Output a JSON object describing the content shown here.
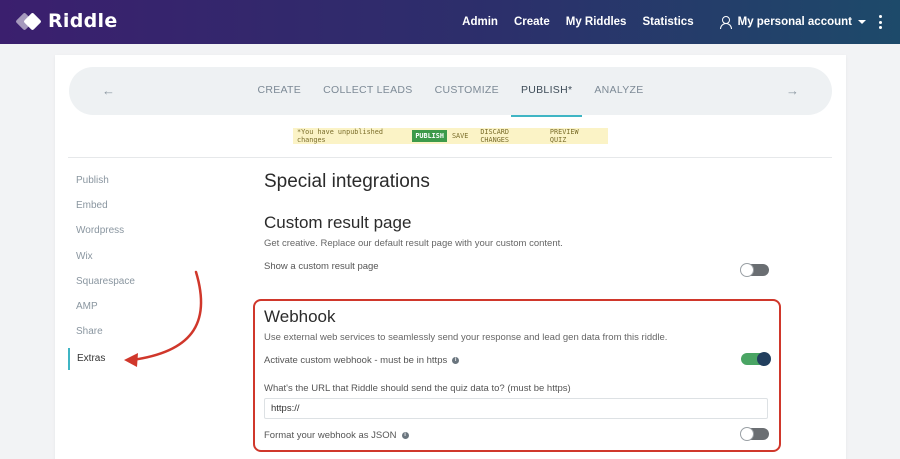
{
  "app": {
    "name": "Riddle"
  },
  "topnav": {
    "links": [
      "Admin",
      "Create",
      "My Riddles",
      "Statistics"
    ],
    "account_label": "My personal account"
  },
  "stepper": {
    "steps": [
      {
        "label": "CREATE",
        "active": false
      },
      {
        "label": "COLLECT LEADS",
        "active": false
      },
      {
        "label": "CUSTOMIZE",
        "active": false
      },
      {
        "label": "PUBLISH*",
        "active": true
      },
      {
        "label": "ANALYZE",
        "active": false
      }
    ],
    "prev_arrow": "←",
    "next_arrow": "→"
  },
  "banner": {
    "note": "*You have unpublished changes",
    "publish": "PUBLISH",
    "save": "SAVE",
    "discard": "DISCARD CHANGES",
    "preview": "PREVIEW QUIZ"
  },
  "sidebar": {
    "items": [
      {
        "label": "Publish",
        "active": false
      },
      {
        "label": "Embed",
        "active": false
      },
      {
        "label": "Wordpress",
        "active": false
      },
      {
        "label": "Wix",
        "active": false
      },
      {
        "label": "Squarespace",
        "active": false
      },
      {
        "label": "AMP",
        "active": false
      },
      {
        "label": "Share",
        "active": false
      },
      {
        "label": "Extras",
        "active": true
      }
    ]
  },
  "content": {
    "title": "Special integrations",
    "custom_result": {
      "heading": "Custom result page",
      "description": "Get creative. Replace our default result page with your custom content.",
      "toggle_label": "Show a custom result page",
      "toggle_on": false
    },
    "webhook": {
      "heading": "Webhook",
      "description": "Use external web services to seamlessly send your response and lead gen data from this riddle.",
      "activate_label": "Activate custom webhook - must be in https",
      "activate_on": true,
      "url_question": "What's the URL that Riddle should send the quiz data to? (must be https)",
      "url_value": "https://",
      "json_label": "Format your webhook as JSON",
      "json_on": false
    }
  },
  "colors": {
    "accent": "#3fb5c4",
    "annotation": "#d0372b",
    "toggle_on": "#4aa564"
  }
}
